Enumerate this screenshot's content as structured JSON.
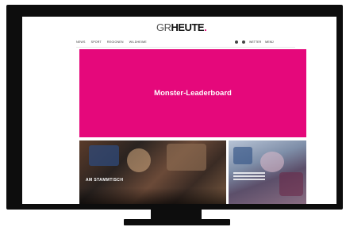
{
  "header": {
    "logo_gr": "GR",
    "logo_heute": "HEUTE",
    "logo_dot": "."
  },
  "nav": {
    "items": [
      "NEWS",
      "SPORT",
      "REGIONEN",
      "WILDHEIME"
    ],
    "right_items": [
      "WETTER",
      "MENÜ"
    ]
  },
  "ad": {
    "label": "Monster-Leaderboard",
    "color": "#e5087b"
  },
  "teasers": {
    "main_headline": "AM STAMMTISCH",
    "main_meta": "",
    "side_headline": ""
  }
}
